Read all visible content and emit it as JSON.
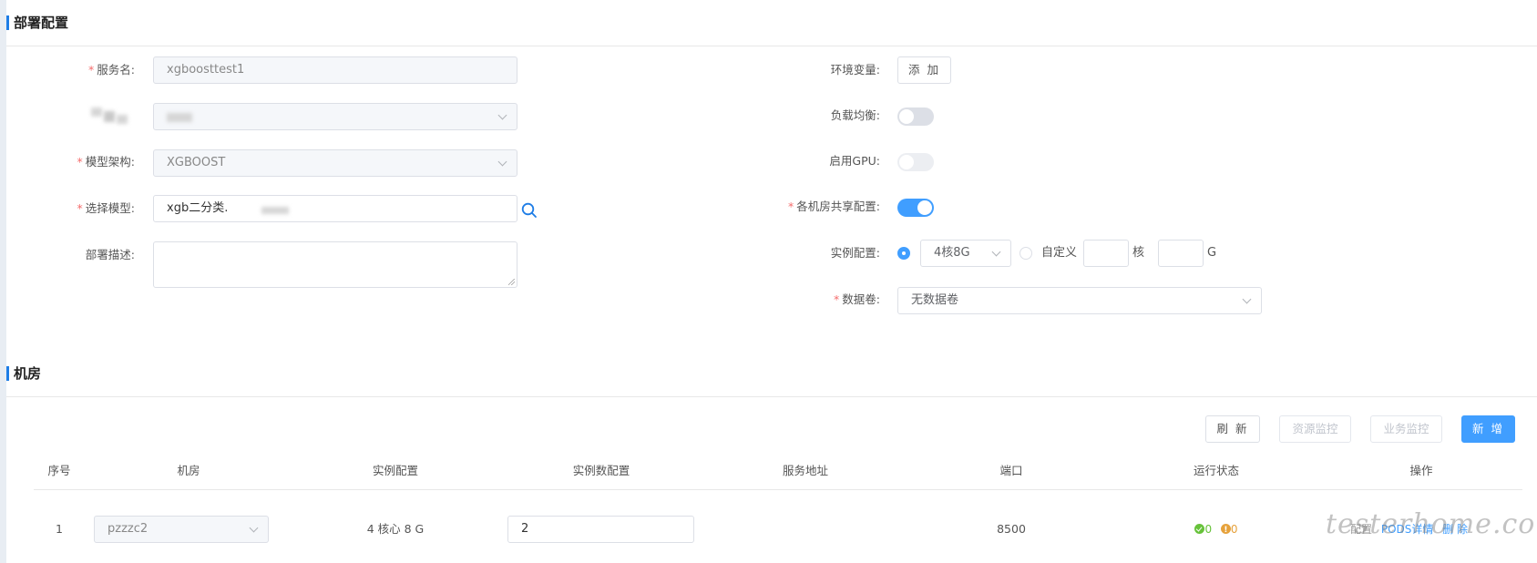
{
  "sections": {
    "deploy_title": "部署配置",
    "room_title": "机房"
  },
  "form_left": {
    "service_name": {
      "label": "服务名:",
      "value": "xgboosttest1"
    },
    "masked_select": {
      "value": ""
    },
    "model_arch": {
      "label": "模型架构:",
      "value": "XGBOOST"
    },
    "select_model": {
      "label": "选择模型:",
      "value": "xgb二分类."
    },
    "description": {
      "label": "部署描述:",
      "value": ""
    }
  },
  "form_right": {
    "env_vars": {
      "label": "环境变量:",
      "button": "添 加"
    },
    "load_balance": {
      "label": "负载均衡:",
      "on": false
    },
    "enable_gpu": {
      "label": "启用GPU:",
      "on": false
    },
    "shared_config": {
      "label": "各机房共享配置:",
      "on": true
    },
    "instance_config": {
      "label": "实例配置:",
      "preset_value": "4核8G",
      "custom_label": "自定义",
      "core_unit": "核",
      "mem_unit": "G",
      "core_value": "",
      "mem_value": ""
    },
    "data_volume": {
      "label": "数据卷:",
      "value": "无数据卷"
    }
  },
  "toolbar": {
    "refresh": "刷 新",
    "resource_monitor": "资源监控",
    "business_monitor": "业务监控",
    "add": "新 增"
  },
  "table": {
    "headers": [
      "序号",
      "机房",
      "实例配置",
      "实例数配置",
      "服务地址",
      "端口",
      "运行状态",
      "操作"
    ],
    "rows": [
      {
        "index": "1",
        "room": "pzzzc2",
        "instance_config": "4 核心 8 G",
        "instance_count": "2",
        "address": "",
        "port": "8500",
        "status_ok": "0",
        "status_warn": "0",
        "actions": [
          "配置",
          "PODS详情",
          "删 除"
        ]
      }
    ]
  },
  "watermark": "testerhome.com",
  "colors": {
    "primary": "#409eff",
    "accent_bar": "#1e7de6",
    "required": "#f56c6c",
    "ok": "#67c23a",
    "warn": "#e6a23c"
  }
}
